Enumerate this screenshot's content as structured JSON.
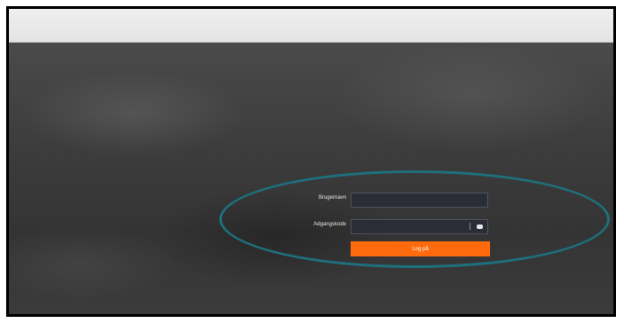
{
  "login": {
    "username_label": "Brugernavn",
    "username_value": "",
    "password_label": "Adgangskode",
    "password_value": "",
    "password_toggle_icon": "eye-icon",
    "submit_label": "Log på"
  },
  "colors": {
    "accent": "#ff6a0d",
    "highlight": "#1f6f7c",
    "topbar": "#ececec",
    "input_bg": "#2a2d36"
  }
}
